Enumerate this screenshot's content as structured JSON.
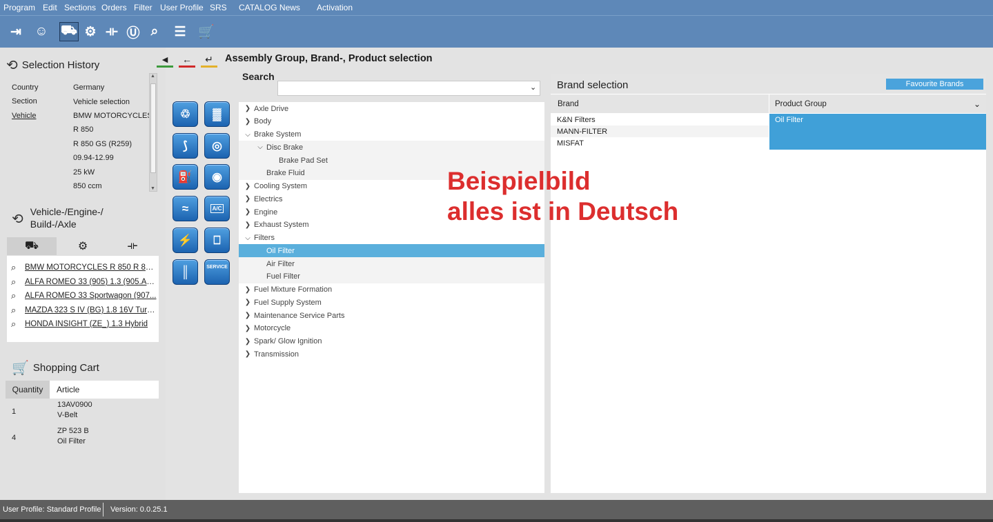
{
  "menu": [
    "Program",
    "Edit",
    "Sections",
    "Orders",
    "Filter",
    "User Profile",
    "SRS",
    "CATALOG News",
    "Activation"
  ],
  "toolbar": {
    "icons": [
      "exit-icon",
      "user-icon",
      "vehicle-icon",
      "engine-icon",
      "axle-icon",
      "u-icon",
      "search-icon",
      "list-icon",
      "cart-icon"
    ]
  },
  "selection_history": {
    "title": "Selection History",
    "rows": [
      {
        "label": "Country",
        "value": "Germany"
      },
      {
        "label": "Section",
        "value": "Vehicle selection"
      },
      {
        "label": "Vehicle",
        "value": "BMW MOTORCYCLES"
      },
      {
        "label": "",
        "value": "R 850"
      },
      {
        "label": "",
        "value": "R 850 GS (R259)"
      },
      {
        "label": "",
        "value": "09.94-12.99"
      },
      {
        "label": "",
        "value": "25 kW"
      },
      {
        "label": "",
        "value": "850 ccm"
      }
    ]
  },
  "vehicle_engine": {
    "title_line1": "Vehicle-/Engine-/",
    "title_line2": "Build-/Axle",
    "recent": [
      "BMW MOTORCYCLES R 850 R 850...",
      "ALFA ROMEO 33 (905) 1.3 (905.A1...",
      "ALFA ROMEO 33 Sportwagon (907...",
      "MAZDA 323 S IV (BG) 1.8 16V Turb...",
      "HONDA INSIGHT (ZE_) 1.3 Hybrid"
    ]
  },
  "shopping_cart": {
    "title": "Shopping Cart",
    "col_quantity": "Quantity",
    "col_article": "Article",
    "items": [
      {
        "qty": "1",
        "number": "13AV0900",
        "name": "V-Belt"
      },
      {
        "qty": "4",
        "number": "ZP 523 B",
        "name": "Oil Filter"
      }
    ]
  },
  "assembly_icons": {
    "labels": [
      "A/C",
      "SERVICE"
    ]
  },
  "header": {
    "title": "Assembly Group, Brand-, Product selection",
    "nav_colors": [
      "#3c9a3c",
      "#d02a2a",
      "#e3b12a"
    ]
  },
  "search": {
    "label": "Search",
    "value": "",
    "placeholder": ""
  },
  "tree": [
    {
      "label": "Axle Drive",
      "level": 0,
      "state": "collapsed"
    },
    {
      "label": "Body",
      "level": 0,
      "state": "collapsed"
    },
    {
      "label": "Brake System",
      "level": 0,
      "state": "expanded"
    },
    {
      "label": "Disc Brake",
      "level": 1,
      "state": "expanded"
    },
    {
      "label": "Brake Pad Set",
      "level": 2,
      "state": "leaf"
    },
    {
      "label": "Brake Fluid",
      "level": 1,
      "state": "leaf"
    },
    {
      "label": "Cooling System",
      "level": 0,
      "state": "collapsed"
    },
    {
      "label": "Electrics",
      "level": 0,
      "state": "collapsed"
    },
    {
      "label": "Engine",
      "level": 0,
      "state": "collapsed"
    },
    {
      "label": "Exhaust System",
      "level": 0,
      "state": "collapsed"
    },
    {
      "label": "Filters",
      "level": 0,
      "state": "expanded"
    },
    {
      "label": "Oil Filter",
      "level": 1,
      "state": "selected"
    },
    {
      "label": "Air Filter",
      "level": 1,
      "state": "leaf"
    },
    {
      "label": "Fuel Filter",
      "level": 1,
      "state": "leaf"
    },
    {
      "label": "Fuel Mixture Formation",
      "level": 0,
      "state": "collapsed"
    },
    {
      "label": "Fuel Supply System",
      "level": 0,
      "state": "collapsed"
    },
    {
      "label": "Maintenance Service Parts",
      "level": 0,
      "state": "collapsed"
    },
    {
      "label": "Motorcycle",
      "level": 0,
      "state": "collapsed"
    },
    {
      "label": "Spark/ Glow Ignition",
      "level": 0,
      "state": "collapsed"
    },
    {
      "label": "Transmission",
      "level": 0,
      "state": "collapsed"
    }
  ],
  "brand_selection": {
    "title": "Brand selection",
    "favourite_button": "Favourite Brands",
    "col_brand": "Brand",
    "col_product_group": "Product Group",
    "brands": [
      "K&N Filters",
      "MANN-FILTER",
      "MISFAT"
    ],
    "product_groups": [
      "Oil Filter"
    ]
  },
  "watermark": {
    "line1": "Beispielbild",
    "line2": "alles ist in Deutsch"
  },
  "status": {
    "profile": "User Profile: Standard Profile",
    "version": "Version: 0.0.25.1"
  },
  "colors": {
    "topbar": "#5e88b8",
    "selection": "#5aafdc",
    "watermark": "#dc2e2e"
  }
}
